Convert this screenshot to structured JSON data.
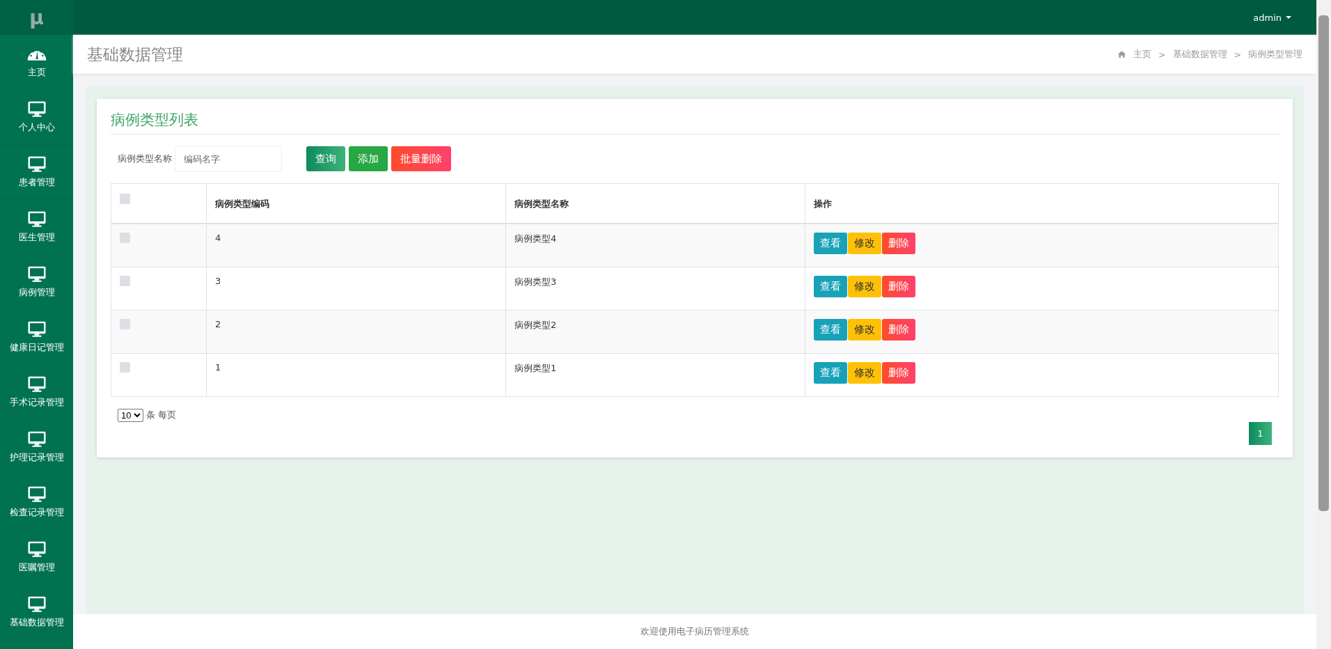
{
  "logo": "μ",
  "sidebar": {
    "items": [
      {
        "label": "主页"
      },
      {
        "label": "个人中心"
      },
      {
        "label": "患者管理"
      },
      {
        "label": "医生管理"
      },
      {
        "label": "病例管理"
      },
      {
        "label": "健康日记管理"
      },
      {
        "label": "手术记录管理"
      },
      {
        "label": "护理记录管理"
      },
      {
        "label": "检查记录管理"
      },
      {
        "label": "医嘱管理"
      },
      {
        "label": "基础数据管理"
      }
    ]
  },
  "topbar": {
    "user": "admin"
  },
  "page_header": {
    "title": "基础数据管理",
    "breadcrumb": [
      "主页",
      "基础数据管理",
      "病例类型管理"
    ],
    "separator": ">"
  },
  "card": {
    "title": "病例类型列表",
    "search": {
      "label": "病例类型名称",
      "placeholder": "编码名字"
    },
    "buttons": [
      {
        "kind": "query",
        "label": "查询"
      },
      {
        "kind": "add",
        "label": "添加"
      },
      {
        "kind": "bulk-delete",
        "label": "批量删除"
      }
    ],
    "table": {
      "columns": [
        "病例类型编码",
        "病例类型名称",
        "操作"
      ],
      "select_all_checked": false,
      "rows": [
        {
          "checked": false,
          "code": "4",
          "name": "病例类型4",
          "actions": [
            {
              "kind": "view",
              "label": "查看"
            },
            {
              "kind": "edit",
              "label": "修改"
            },
            {
              "kind": "delete",
              "label": "删除"
            }
          ]
        },
        {
          "checked": false,
          "code": "3",
          "name": "病例类型3",
          "actions": [
            {
              "kind": "view",
              "label": "查看"
            },
            {
              "kind": "edit",
              "label": "修改"
            },
            {
              "kind": "delete",
              "label": "删除"
            }
          ]
        },
        {
          "checked": false,
          "code": "2",
          "name": "病例类型2",
          "actions": [
            {
              "kind": "view",
              "label": "查看"
            },
            {
              "kind": "edit",
              "label": "修改"
            },
            {
              "kind": "delete",
              "label": "删除"
            }
          ]
        },
        {
          "checked": false,
          "code": "1",
          "name": "病例类型1",
          "actions": [
            {
              "kind": "view",
              "label": "查看"
            },
            {
              "kind": "edit",
              "label": "修改"
            },
            {
              "kind": "delete",
              "label": "删除"
            }
          ]
        }
      ]
    },
    "page_size": {
      "value": "10",
      "suffix": "条 每页"
    },
    "pages": [
      {
        "label": "1",
        "selected": true
      }
    ]
  },
  "footer": "欢迎使用电子病历管理系统"
}
